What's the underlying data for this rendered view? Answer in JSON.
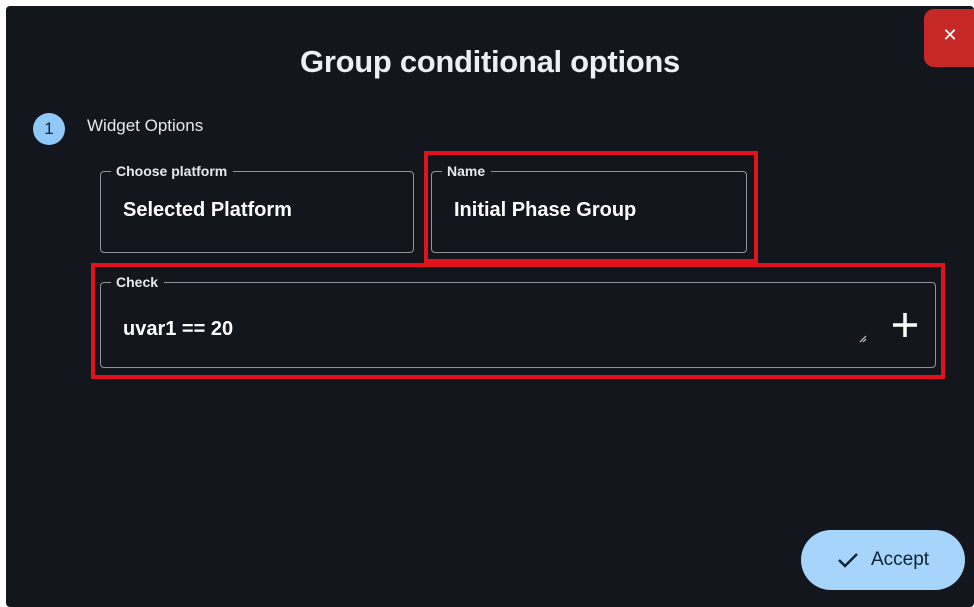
{
  "dialog": {
    "title": "Group conditional options",
    "close_icon": "close-icon"
  },
  "step": {
    "number": "1",
    "label": "Widget Options"
  },
  "fields": {
    "platform": {
      "label": "Choose platform",
      "value": "Selected Platform"
    },
    "name": {
      "label": "Name",
      "value": "Initial Phase Group"
    },
    "check": {
      "label": "Check",
      "value": "uvar1 == 20",
      "add_icon": "plus-icon",
      "resize_icon": "resize-grip-icon"
    }
  },
  "actions": {
    "accept_label": "Accept",
    "accept_icon": "checkmark-icon"
  },
  "colors": {
    "background": "#13161d",
    "accent": "#a6d4fa",
    "close": "#c62828",
    "highlight": "#e0121c"
  }
}
